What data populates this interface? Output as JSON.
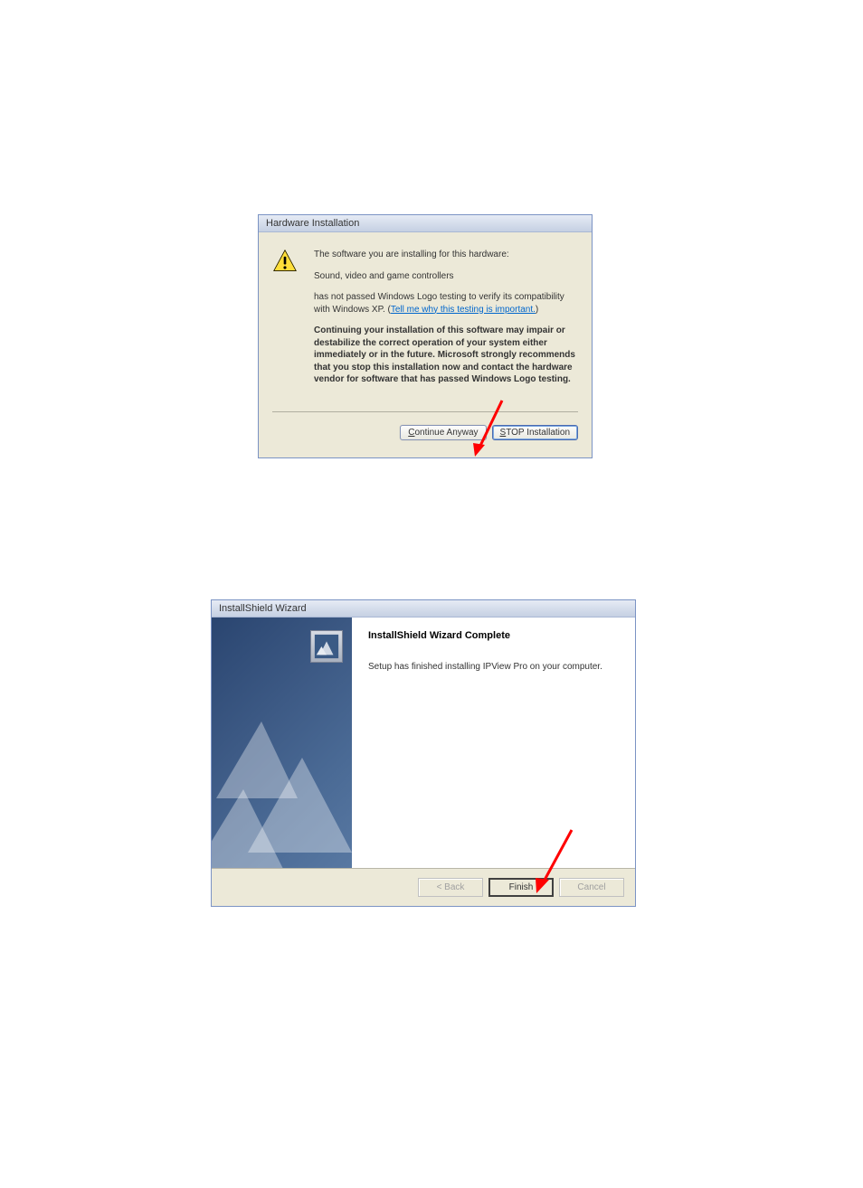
{
  "dialog1": {
    "title": "Hardware Installation",
    "line1": "The software you are installing for this hardware:",
    "line2": "Sound, video and game controllers",
    "line3a": "has not passed Windows Logo testing to verify its compatibility with Windows XP. (",
    "link": "Tell me why this testing is important.",
    "line3b": ")",
    "bold_text": "Continuing your installation of this software may impair or destabilize the correct operation of your system either immediately or in the future. Microsoft strongly recommends that you stop this installation now and contact the hardware vendor for software that has passed Windows Logo testing.",
    "btn_continue": "Continue Anyway",
    "btn_stop": "STOP Installation"
  },
  "dialog2": {
    "title": "InstallShield Wizard",
    "heading": "InstallShield Wizard Complete",
    "body": "Setup has finished installing IPView Pro on your computer.",
    "btn_back": "< Back",
    "btn_finish": "Finish",
    "btn_cancel": "Cancel"
  }
}
